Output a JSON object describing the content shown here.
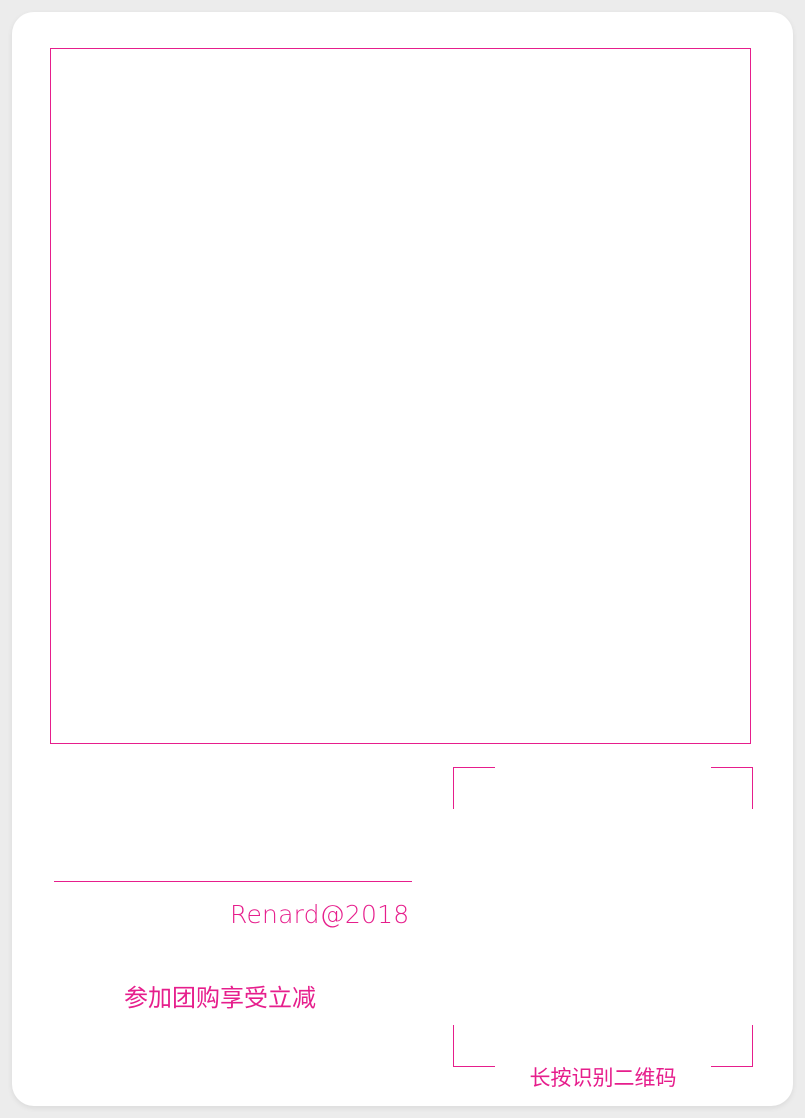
{
  "poster": {
    "signature": "Renard@2018",
    "promo_text": "参加团购享受立减",
    "qr_caption": "长按识别二维码"
  },
  "colors": {
    "accent": "#e61e8c",
    "card_background": "#ffffff",
    "page_background": "#ececec"
  }
}
